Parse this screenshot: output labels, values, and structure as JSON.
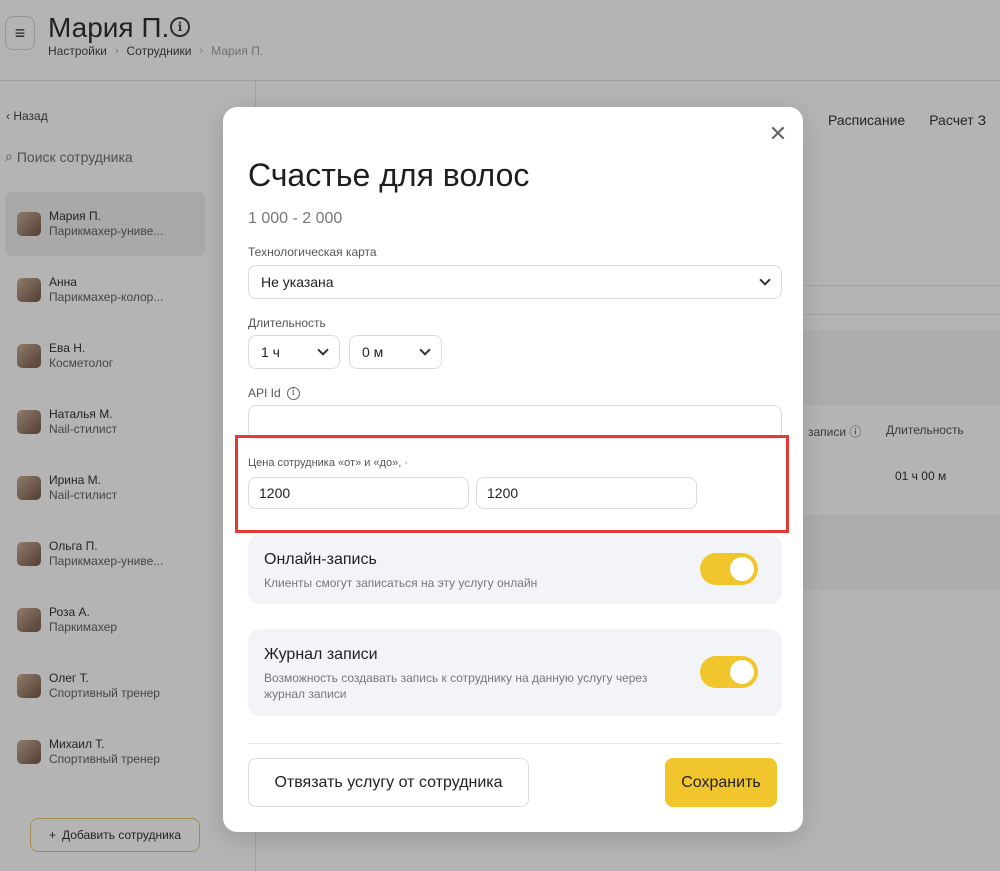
{
  "header": {
    "title": "Мария П.",
    "breadcrumbs": [
      "Настройки",
      "Сотрудники",
      "Мария П."
    ]
  },
  "sidebar": {
    "back_label": "Назад",
    "search_placeholder": "Поиск сотрудника",
    "employees": [
      {
        "name": "Мария П.",
        "role": "Парикмахер-униве..."
      },
      {
        "name": "Анна",
        "role": "Парикмахер-колор..."
      },
      {
        "name": "Ева Н.",
        "role": "Косметолог"
      },
      {
        "name": "Наталья М.",
        "role": "Nail-стилист"
      },
      {
        "name": "Ирина М.",
        "role": "Nail-стилист"
      },
      {
        "name": "Ольга П.",
        "role": "Парикмахер-униве..."
      },
      {
        "name": "Роза А.",
        "role": "Паркимахер"
      },
      {
        "name": "Олег Т.",
        "role": "Спортивный тренер"
      },
      {
        "name": "Михаил Т.",
        "role": "Спортивный тренер"
      }
    ],
    "add_button_label": "Добавить сотрудника"
  },
  "tabs": [
    "Расписание",
    "Расчет З"
  ],
  "table": {
    "headers": [
      "записи",
      "Длительность"
    ],
    "duration_value": "01 ч 00 м"
  },
  "modal": {
    "title": "Счастье для волос",
    "price_range": "1 000 - 2 000",
    "tech_card_label": "Технологическая карта",
    "tech_card_value": "Не указана",
    "duration_label": "Длительность",
    "duration_hours": "1 ч",
    "duration_minutes": "0 м",
    "api_label": "API Id",
    "api_value": "",
    "price_label": "Цена сотрудника «от» и «до», ·",
    "price_from": "1200",
    "price_to": "1200",
    "online_title": "Онлайн-запись",
    "online_desc": "Клиенты смогут записаться на эту услугу онлайн",
    "online_enabled": true,
    "journal_title": "Журнал записи",
    "journal_desc": "Возможность создавать запись к сотруднику на данную услугу через журнал записи",
    "journal_enabled": true,
    "unlink_label": "Отвязать услугу от сотрудника",
    "save_label": "Сохранить"
  },
  "colors": {
    "accent": "#f0c62c",
    "highlight": "#e53935"
  }
}
